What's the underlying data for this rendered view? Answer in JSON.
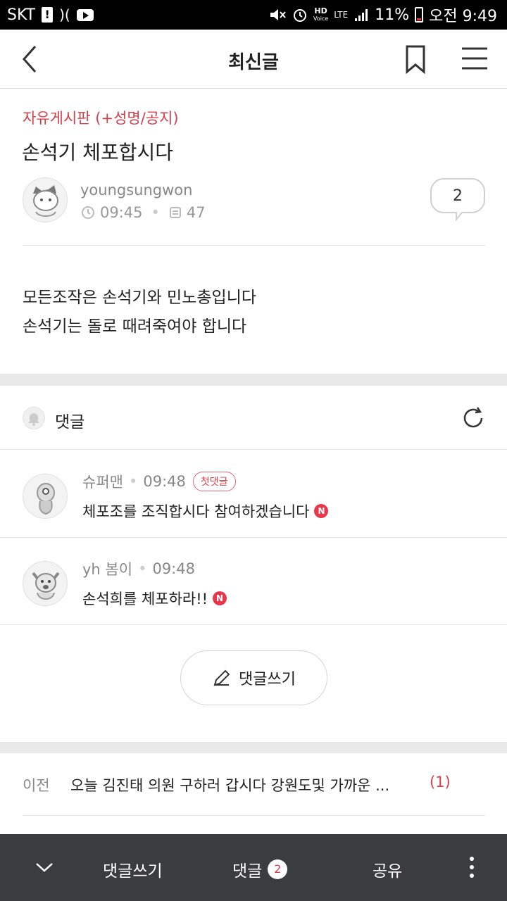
{
  "status_bar": {
    "carrier": "SKT",
    "battery": "11%",
    "time": "오전 9:49",
    "network": "LTE",
    "hd_label": "HD",
    "voice_label": "Voice"
  },
  "header": {
    "title": "최신글"
  },
  "post": {
    "board": "자유게시판 (+성명/공지)",
    "title": "손석기 체포합시다",
    "author": "youngsungwon",
    "time": "09:45",
    "views": "47",
    "comment_count": "2",
    "body_lines": [
      "모든조작은 손석기와 민노총입니다",
      "손석기는 돌로 때려죽여야 합니다"
    ]
  },
  "comments_section": {
    "label": "댓글",
    "items": [
      {
        "author": "슈퍼맨",
        "time": "09:48",
        "badge": "첫댓글",
        "text": "체포조를 조직합시다 참여하겠습니다",
        "new_badge": "N"
      },
      {
        "author": "yh 봄이",
        "time": "09:48",
        "text": "손석희를 체포하라!!",
        "new_badge": "N"
      }
    ],
    "write_button": "댓글쓰기"
  },
  "prev_post": {
    "label": "이전",
    "title": "오늘 김진태 의원 구하러 갑시다 강원도및 가까운 ...",
    "count": "(1)"
  },
  "bottom_bar": {
    "write_label": "댓글쓰기",
    "comments_label": "댓글",
    "comments_count": "2",
    "share_label": "공유"
  },
  "colors": {
    "accent": "#d7404b",
    "bottom_bar": "#3b3c3e",
    "divider": "#e2e2e2"
  }
}
